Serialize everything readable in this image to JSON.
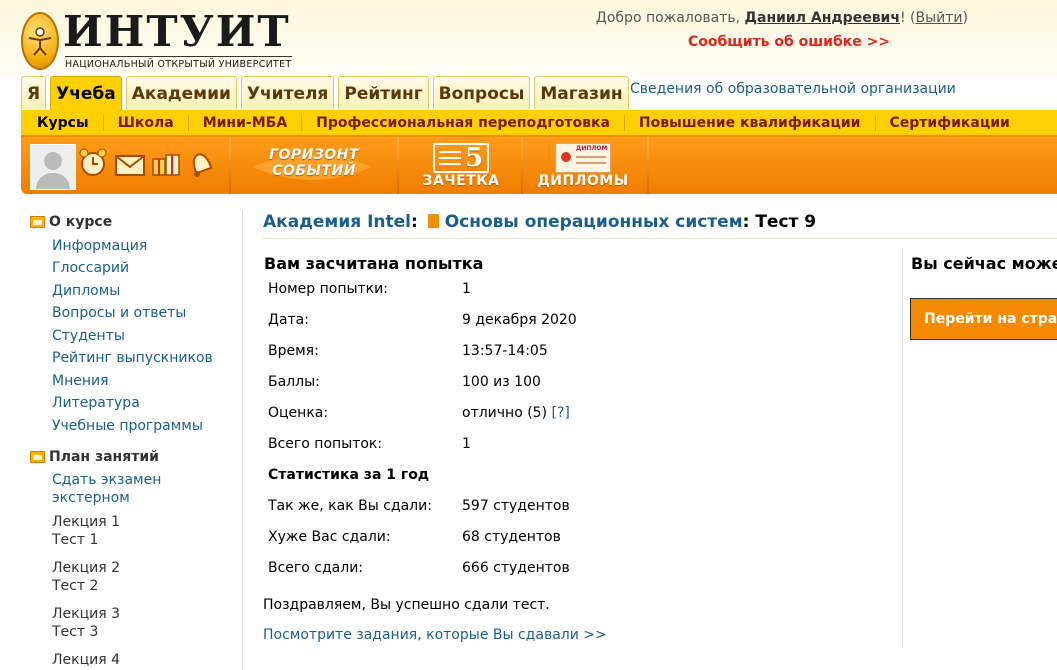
{
  "logo": {
    "title": "ИНТУИТ",
    "subtitle": "НАЦИОНАЛЬНЫЙ ОТКРЫТЫЙ УНИВЕРСИТЕТ"
  },
  "header": {
    "welcome_prefix": "Добро пожаловать, ",
    "user_name": "Даниил Андреевич",
    "welcome_mid": "! (",
    "logout": "Выйти",
    "welcome_end": ")",
    "report_error": "Сообщить об ошибке >>"
  },
  "tabs": [
    {
      "label": "Я"
    },
    {
      "label": "Учеба",
      "active": true
    },
    {
      "label": "Академии"
    },
    {
      "label": "Учителя"
    },
    {
      "label": "Рейтинг"
    },
    {
      "label": "Вопросы"
    },
    {
      "label": "Магазин"
    }
  ],
  "org_info_link": "Сведения об образовательной организации",
  "subnav": [
    "Курсы",
    "Школа",
    "Мини-МБА",
    "Профессиональная переподготовка",
    "Повышение квалификации",
    "Сертификации"
  ],
  "toolbar": {
    "icons": [
      "alarm-clock-icon",
      "envelope-icon",
      "gifts-icon",
      "bell-icon"
    ],
    "horizon_line1": "ГОРИЗОНТ",
    "horizon_line2": "СОБЫТИЙ",
    "record_number": "5",
    "record_label": "ЗАЧЕТКА",
    "diplomas_label": "ДИПЛОМЫ",
    "diploma_card_text": "ДИПЛОМ"
  },
  "sidebar": {
    "about_title": "О курсе",
    "about_links": [
      "Информация",
      "Глоссарий",
      "Дипломы",
      "Вопросы и ответы",
      "Студенты",
      "Рейтинг выпускников",
      "Мнения",
      "Литература",
      "Учебные программы"
    ],
    "plan_title": "План занятий",
    "exam_link": "Сдать экзамен экстерном",
    "lectures": [
      {
        "lecture": "Лекция 1",
        "test": "Тест 1"
      },
      {
        "lecture": "Лекция 2",
        "test": "Тест 2"
      },
      {
        "lecture": "Лекция 3",
        "test": "Тест 3"
      },
      {
        "lecture": "Лекция 4",
        "test": ""
      }
    ]
  },
  "breadcrumb": {
    "academy": "Академия Intel",
    "sep1": ": ",
    "course": "Основы операционных систем",
    "sep2": ": ",
    "current": "Тест 9"
  },
  "result": {
    "title": "Вам засчитана попытка",
    "rows": [
      {
        "label": "Номер попытки:",
        "value": "1"
      },
      {
        "label": "Дата:",
        "value": "9 декабря 2020"
      },
      {
        "label": "Время:",
        "value": "13:57-14:05"
      },
      {
        "label": "Баллы:",
        "value": "100 из 100"
      },
      {
        "label": "Оценка:",
        "value": "отлично (5)",
        "help": "[?]"
      },
      {
        "label": "Всего попыток:",
        "value": "1"
      }
    ],
    "stats_title": "Статистика за 1 год",
    "stats": [
      {
        "label": "Так же, как Вы сдали:",
        "value": "597 студентов"
      },
      {
        "label": "Хуже Вас сдали:",
        "value": "68 студентов"
      },
      {
        "label": "Всего сдали:",
        "value": "666 студентов"
      }
    ],
    "congrats": "Поздравляем, Вы успешно сдали тест.",
    "view_tasks_link": "Посмотрите задания, которые Вы сдавали >>"
  },
  "right_panel": {
    "title": "Вы сейчас може",
    "button": "Перейти на стран"
  },
  "colors": {
    "accent_orange": "#f58a00",
    "tab_yellow": "#ffd000",
    "link_blue": "#1a5f8c",
    "error_red": "#e0261c"
  }
}
